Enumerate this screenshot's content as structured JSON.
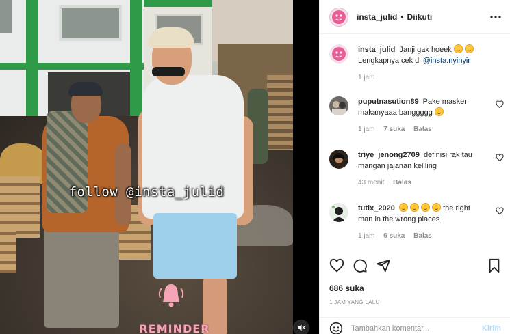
{
  "video": {
    "overlay_text": "follow @insta_julid",
    "reminder_text": "REMINDER"
  },
  "header": {
    "username": "insta_julid",
    "separator": "•",
    "follow_status": "Diikuti"
  },
  "caption": {
    "username": "insta_julid",
    "text_line1": "Janji gak hoeek",
    "text_line2": "Lengkapnya cek di",
    "mention": "@insta.nyinyir",
    "time": "1 jam"
  },
  "comments": [
    {
      "username": "puputnasution89",
      "text_line1": "Pake masker",
      "text_line2": "makanyaaa banggggg",
      "time": "1 jam",
      "likes": "7 suka",
      "reply": "Balas"
    },
    {
      "username": "triye_jenong2709",
      "text_line1": "definisi rak tau",
      "text_line2": "mangan jajanan keliling",
      "time": "43 menit",
      "reply": "Balas"
    },
    {
      "username": "tutix_2020",
      "text_line1": "the right",
      "text_line2": "man in the wrong places",
      "time": "1 jam",
      "likes": "6 suka",
      "reply": "Balas"
    }
  ],
  "stats": {
    "likes": "686 suka",
    "posted_ago": "1 JAM YANG LALU"
  },
  "add_comment": {
    "placeholder": "Tambahkan komentar...",
    "post_label": "Kirim"
  },
  "colors": {
    "text": "#262626",
    "muted": "#8e8e8e",
    "mention": "#00376b",
    "post_disabled": "#b2dffc",
    "border": "#efefef"
  }
}
